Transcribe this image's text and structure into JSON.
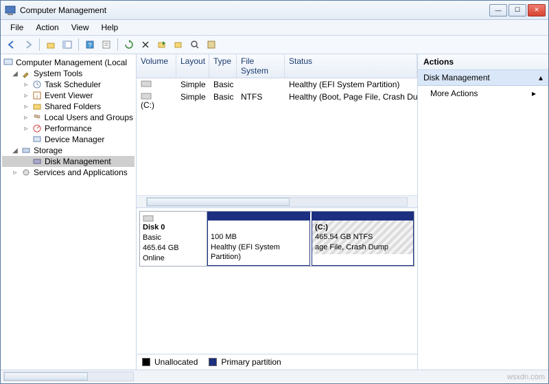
{
  "window": {
    "title": "Computer Management"
  },
  "menu": {
    "file": "File",
    "action": "Action",
    "view": "View",
    "help": "Help"
  },
  "tree": {
    "root": "Computer Management (Local",
    "system_tools": "System Tools",
    "task_scheduler": "Task Scheduler",
    "event_viewer": "Event Viewer",
    "shared_folders": "Shared Folders",
    "local_users": "Local Users and Groups",
    "performance": "Performance",
    "device_manager": "Device Manager",
    "storage": "Storage",
    "disk_management": "Disk Management",
    "services_apps": "Services and Applications"
  },
  "columns": {
    "volume": "Volume",
    "layout": "Layout",
    "type": "Type",
    "fs": "File System",
    "status": "Status"
  },
  "volumes": [
    {
      "volume": "",
      "layout": "Simple",
      "type": "Basic",
      "fs": "",
      "status": "Healthy (EFI System Partition)"
    },
    {
      "volume": "(C:)",
      "layout": "Simple",
      "type": "Basic",
      "fs": "NTFS",
      "status": "Healthy (Boot, Page File, Crash Dum"
    }
  ],
  "disk": {
    "name": "Disk 0",
    "type": "Basic",
    "size": "465.64 GB",
    "state": "Online",
    "partitions": [
      {
        "label": "",
        "size": "100 MB",
        "status": "Healthy (EFI System Partition)"
      },
      {
        "label": "(C:)",
        "size": "465.54 GB NTFS",
        "status": "age File, Crash Dump"
      }
    ]
  },
  "legend": {
    "unallocated": "Unallocated",
    "primary": "Primary partition"
  },
  "actions": {
    "heading": "Actions",
    "section": "Disk Management",
    "more": "More Actions"
  },
  "watermark": "wsxdn.com"
}
